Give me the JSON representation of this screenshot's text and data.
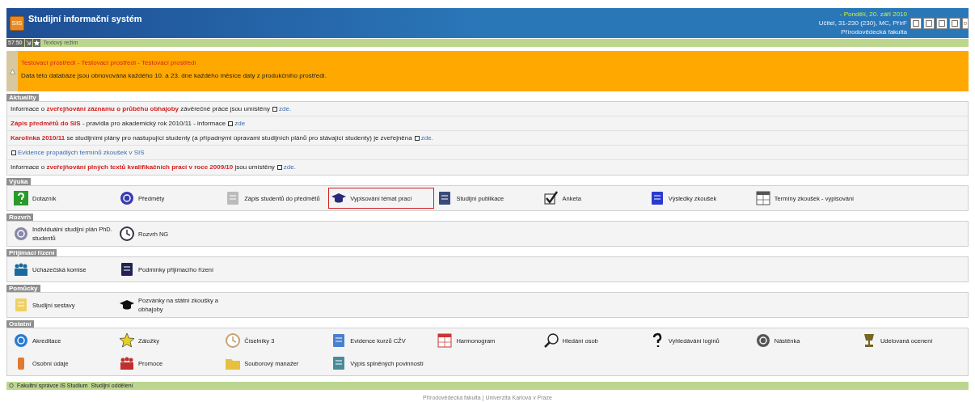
{
  "header": {
    "logo": "SIS",
    "title": "Studijní informační systém",
    "date": "- Pondělí, 20. září 2010",
    "role": "Učitel, 31-230 (230), MC, PřírF",
    "faculty": "Přírodovědecká fakulta"
  },
  "toolbar": {
    "timer": "57:50",
    "mode_link": "Textový režim"
  },
  "notice": {
    "title": "Testovací prostředí - Testovací prostředí - Testovací prostředí",
    "text": "Data této databáze jsou obnovována každého 10. a 23. dne každého měsíce daty z produkčního prostředí."
  },
  "news": {
    "label": "Aktuality",
    "items": [
      {
        "text": "Informace o **zveřejňování záznamu o průběhu obhajoby** závěrečné práce jsou umístěny",
        "link": "zde."
      },
      {
        "text": "**Zápis předmětů do SIS** - pravidla pro akademický rok 2010/11 - informace",
        "link": "zde"
      },
      {
        "text": "**Karolinka 2010/11** se studijními plány pro nastupující studenty (a případnými úpravami studijních plánů pro stávající studenty) je zveřejněna",
        "link": "zde."
      },
      {
        "link": "Evidence propadlých termínů zkoušek v SIS"
      },
      {
        "text": "Informace o **zveřejňování plných textů kvalifikačních prací v roce 2009/10** jsou umístěny",
        "link": "zde."
      }
    ]
  },
  "sections": [
    {
      "label": "Výuka",
      "items": [
        {
          "label": "Dotazník",
          "selected": false
        },
        {
          "label": "Předměty",
          "selected": false
        },
        {
          "label": "Zápis studentů do předmětů",
          "selected": false
        },
        {
          "label": "Vypisování témat prací",
          "selected": true
        },
        {
          "label": "Studijní publikace",
          "selected": false
        },
        {
          "label": "Anketa",
          "selected": false
        },
        {
          "label": "Výsledky zkoušek",
          "selected": false
        },
        {
          "label": "Termíny zkoušek - vypisování",
          "selected": false
        }
      ]
    },
    {
      "label": "Rozvrh",
      "items": [
        {
          "label": "Individuální studijní plán PhD. studentů",
          "selected": false
        },
        {
          "label": "Rozvrh NG",
          "selected": false
        }
      ]
    },
    {
      "label": "Přijímací řízení",
      "items": [
        {
          "label": "Uchazečská komise",
          "selected": false
        },
        {
          "label": "Podmínky přijímacího řízení",
          "selected": false
        }
      ]
    },
    {
      "label": "Pomůcky",
      "items": [
        {
          "label": "Studijní sestavy",
          "selected": false
        },
        {
          "label": "Pozvánky na státní zkoušky a obhajoby",
          "selected": false
        }
      ]
    },
    {
      "label": "Ostatní",
      "items": [
        {
          "label": "Akreditace",
          "selected": false
        },
        {
          "label": "Záložky",
          "selected": false
        },
        {
          "label": "Číselníky 3",
          "selected": false
        },
        {
          "label": "Evidence kurzů CŽV",
          "selected": false
        },
        {
          "label": "Harmonogram",
          "selected": false
        },
        {
          "label": "Hledání osob",
          "selected": false
        },
        {
          "label": "Vyhledávání loginů",
          "selected": false
        },
        {
          "label": "Nástěnka",
          "selected": false
        },
        {
          "label": "Udelovaná ocenení",
          "selected": false
        },
        {
          "label": "Osobní údaje",
          "selected": false
        },
        {
          "label": "Promoce",
          "selected": false
        },
        {
          "label": "Souborový manažer",
          "selected": false
        },
        {
          "label": "Výpis splněných povinností",
          "selected": false
        }
      ]
    }
  ],
  "footer_bar": {
    "admin": "Fakultní správce IS Studium",
    "office": "Studijní oddělení"
  },
  "footer": "Přírodovědecká fakulta | Univerzita Karlova v Praze"
}
